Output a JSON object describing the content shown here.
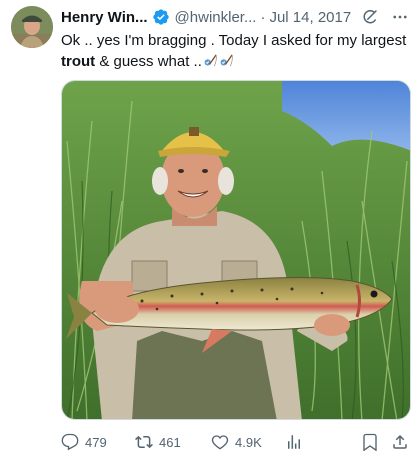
{
  "tweet": {
    "author_name": "Henry Win...",
    "handle": "@hwinkler...",
    "separator": "·",
    "date": "Jul 14, 2017",
    "text_part1": "Ok .. yes I'm bragging . Today I asked for my largest ",
    "text_bold": "trout",
    "text_part2": " & guess what ..",
    "emoji": [
      "fishing-pole-emoji",
      "fishing-pole-emoji"
    ],
    "image_description_alt": "Man in a tan cap holding a large rainbow trout among tall green grass"
  },
  "actions": {
    "replies": "479",
    "retweets": "461",
    "likes": "4.9K"
  },
  "colors": {
    "verified_blue": "#1d9bf0",
    "text_secondary": "#536471",
    "text_primary": "#0f1419"
  },
  "icons": [
    "verified-badge-icon",
    "grok-icon",
    "more-icon",
    "reply-icon",
    "retweet-icon",
    "like-icon",
    "views-icon",
    "bookmark-icon",
    "share-icon"
  ]
}
